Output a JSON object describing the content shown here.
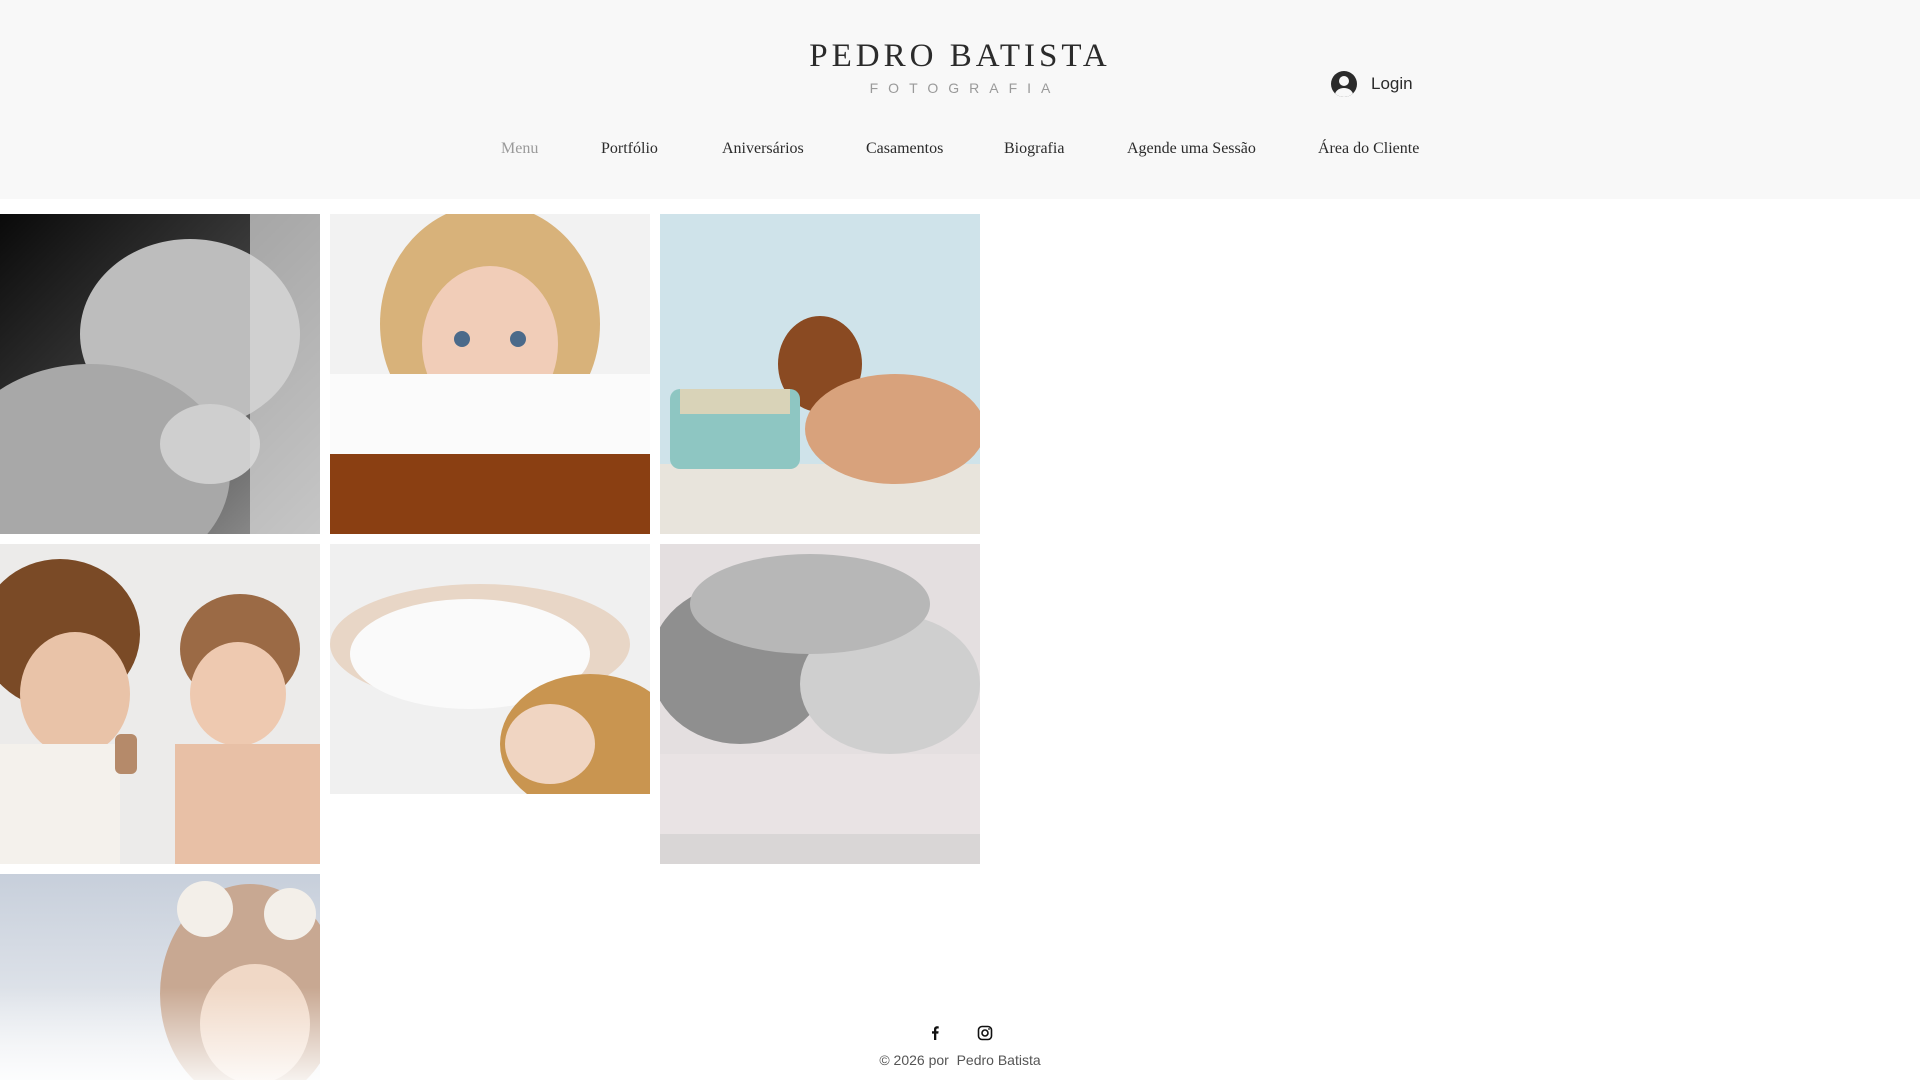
{
  "header": {
    "title": "PEDRO BATISTA",
    "subtitle": "FOTOGRAFIA",
    "login_label": "Login"
  },
  "nav": {
    "items": [
      {
        "label": "Menu",
        "active": true
      },
      {
        "label": "Portfólio",
        "active": false
      },
      {
        "label": "Aniversários",
        "active": false
      },
      {
        "label": "Casamentos",
        "active": false
      },
      {
        "label": "Biografia",
        "active": false
      },
      {
        "label": "Agende uma Sessão",
        "active": false
      },
      {
        "label": "Área do Cliente",
        "active": false
      }
    ]
  },
  "gallery": {
    "photos": [
      {
        "subject": "sleeping newborn, black and white"
      },
      {
        "subject": "blonde girl peeking over tub edge"
      },
      {
        "subject": "child leaning on vintage typewriter"
      },
      {
        "subject": "two children sharing a cup"
      },
      {
        "subject": "woman lying on white bed"
      },
      {
        "subject": "mother and child asleep, monochrome"
      },
      {
        "subject": "baby in bear-ear hood"
      }
    ]
  },
  "footer": {
    "social": [
      "facebook-icon",
      "instagram-icon"
    ],
    "copyright": "© 2026 por  Pedro Batista"
  },
  "colors": {
    "header_bg": "#f8f8f8",
    "text": "#2b2b2b",
    "muted": "#9a9a9a"
  }
}
